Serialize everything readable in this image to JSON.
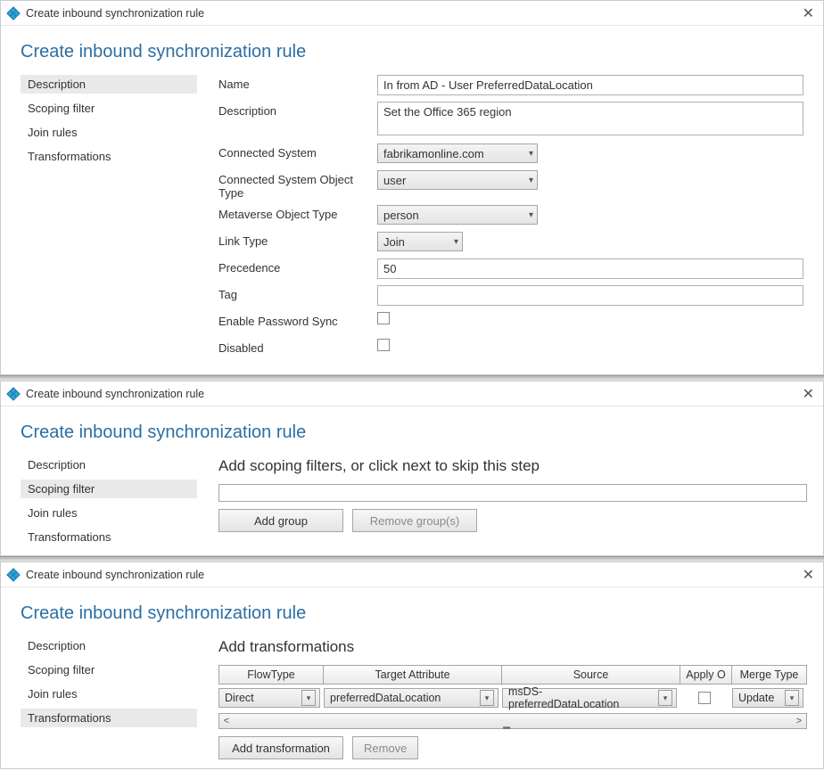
{
  "common": {
    "window_title": "Create inbound synchronization rule",
    "page_heading": "Create inbound synchronization rule",
    "close_glyph": "✕"
  },
  "sidebar": {
    "items": [
      {
        "label": "Description"
      },
      {
        "label": "Scoping filter"
      },
      {
        "label": "Join rules"
      },
      {
        "label": "Transformations"
      }
    ]
  },
  "panel1": {
    "selected_index": 0,
    "form": {
      "name_label": "Name",
      "name_value": "In from AD - User PreferredDataLocation",
      "desc_label": "Description",
      "desc_value": "Set the Office 365 region",
      "connsys_label": "Connected System",
      "connsys_value": "fabrikamonline.com",
      "csot_label": "Connected System Object Type",
      "csot_value": "user",
      "mvot_label": "Metaverse Object Type",
      "mvot_value": "person",
      "linktype_label": "Link Type",
      "linktype_value": "Join",
      "prec_label": "Precedence",
      "prec_value": "50",
      "tag_label": "Tag",
      "tag_value": "",
      "eps_label": "Enable Password Sync",
      "disabled_label": "Disabled"
    }
  },
  "panel2": {
    "selected_index": 1,
    "section_title": "Add scoping filters, or click next to skip this step",
    "btn_add_group": "Add group",
    "btn_remove_groups": "Remove group(s)"
  },
  "panel3": {
    "selected_index": 3,
    "section_title": "Add transformations",
    "grid": {
      "headers": [
        "FlowType",
        "Target Attribute",
        "Source",
        "Apply O",
        "Merge Type"
      ],
      "row": {
        "flowtype": "Direct",
        "target": "preferredDataLocation",
        "source": "msDS-preferredDataLocation",
        "merge": "Update"
      }
    },
    "btn_add_transform": "Add transformation",
    "btn_remove": "Remove"
  }
}
